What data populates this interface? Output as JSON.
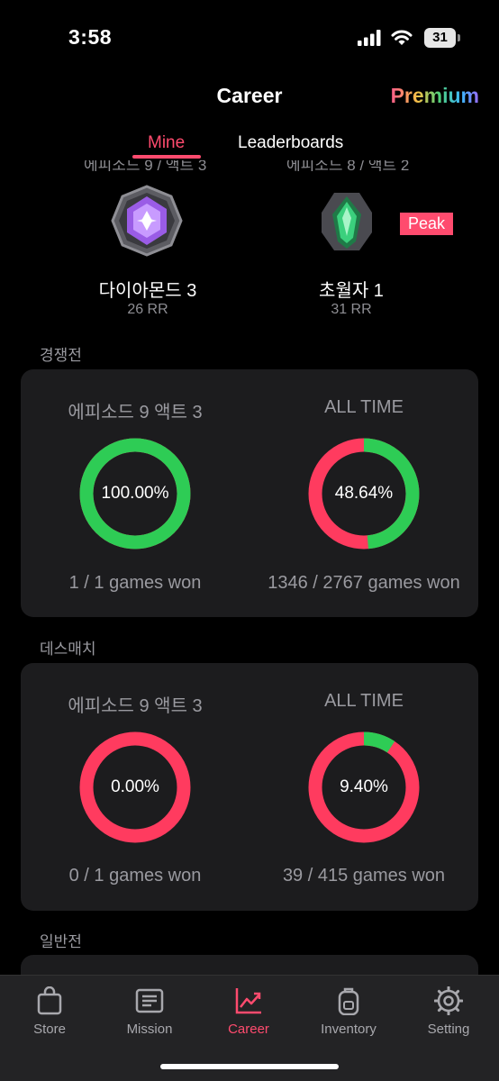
{
  "status_bar": {
    "time": "3:58",
    "battery": "31"
  },
  "header": {
    "title": "Career",
    "premium_label": "Premium"
  },
  "tabs": {
    "mine": "Mine",
    "leaderboards": "Leaderboards"
  },
  "ranks": {
    "current": {
      "season_label": "에피소드 9 / 액트 3",
      "name": "다이아몬드 3",
      "rr": "26 RR",
      "icon": "diamond-rank-icon",
      "color": "#b06cf2"
    },
    "peak": {
      "season_label": "에피소드 8 / 액트 2",
      "name": "초월자 1",
      "rr": "31 RR",
      "icon": "ascendant-rank-icon",
      "badge": "Peak",
      "color": "#2fae62"
    }
  },
  "sections": {
    "competitive": {
      "label": "경쟁전",
      "current": {
        "title": "에피소드 9 액트 3",
        "percent": "100.00%",
        "win_fraction": 1.0,
        "games": "1 / 1 games won"
      },
      "all_time": {
        "title": "ALL TIME",
        "percent": "48.64%",
        "win_fraction": 0.4864,
        "games": "1346 / 2767 games won"
      }
    },
    "deathmatch": {
      "label": "데스매치",
      "current": {
        "title": "에피소드 9 액트 3",
        "percent": "0.00%",
        "win_fraction": 0.0,
        "games": "0 / 1 games won"
      },
      "all_time": {
        "title": "ALL TIME",
        "percent": "9.40%",
        "win_fraction": 0.094,
        "games": "39 / 415 games won"
      }
    },
    "unrated": {
      "label": "일반전"
    }
  },
  "colors": {
    "accent": "#ff4b6e",
    "win": "#2ecc55",
    "loss": "#ff3b5f",
    "card": "#1c1c1e"
  },
  "tab_bar": {
    "items": [
      {
        "label": "Store",
        "icon": "bag-icon"
      },
      {
        "label": "Mission",
        "icon": "mission-icon"
      },
      {
        "label": "Career",
        "icon": "chart-icon",
        "active": true
      },
      {
        "label": "Inventory",
        "icon": "backpack-icon"
      },
      {
        "label": "Setting",
        "icon": "gear-icon"
      }
    ]
  }
}
